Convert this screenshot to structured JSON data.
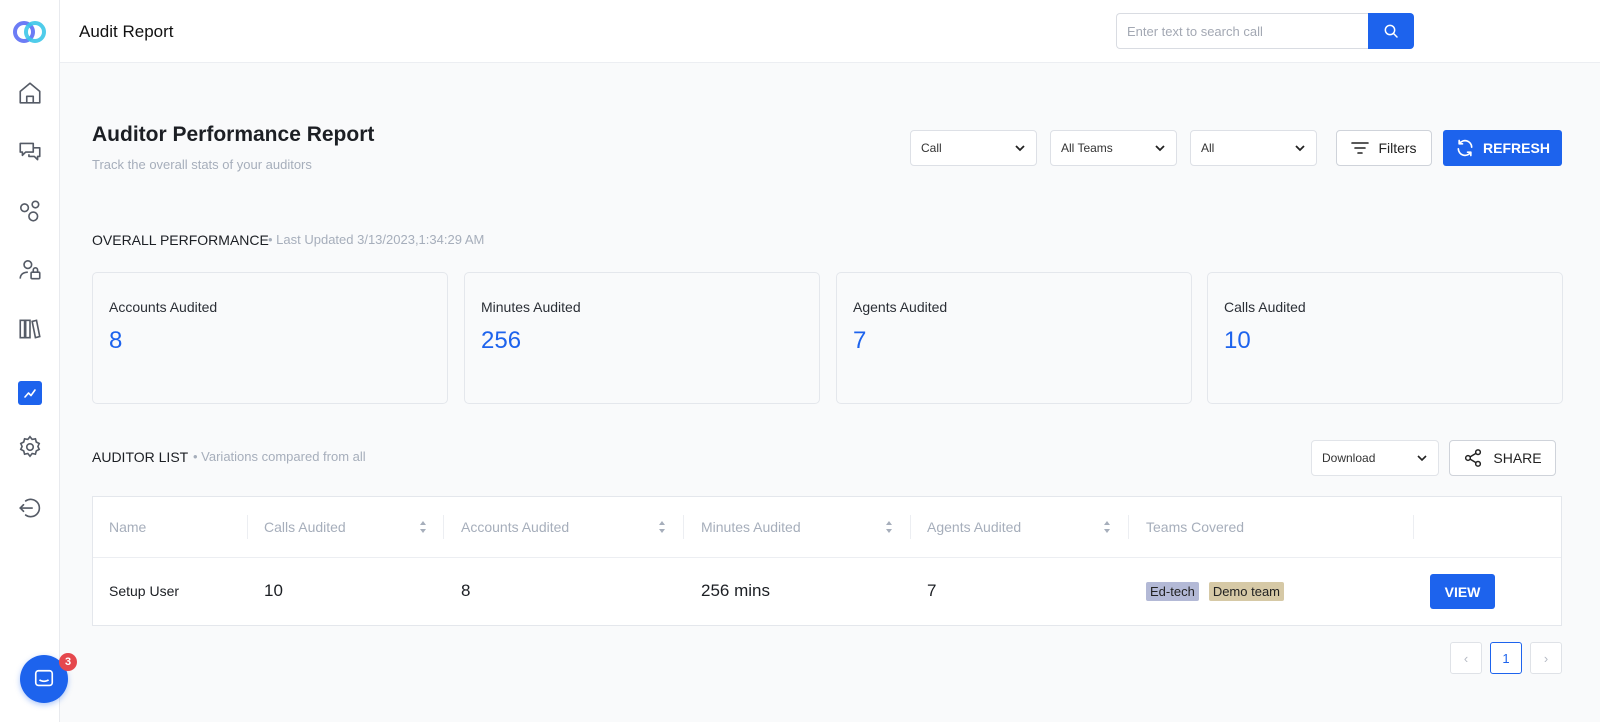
{
  "header": {
    "title": "Audit Report",
    "search_placeholder": "Enter text to search call"
  },
  "sidebar": {
    "items": [
      {
        "icon": "home-icon"
      },
      {
        "icon": "chat-icon"
      },
      {
        "icon": "bubbles-icon"
      },
      {
        "icon": "user-lock-icon"
      },
      {
        "icon": "library-icon"
      },
      {
        "icon": "chart-line-icon",
        "active": true
      },
      {
        "icon": "gear-icon"
      },
      {
        "icon": "logout-icon"
      }
    ],
    "chat_badge": "3"
  },
  "report": {
    "title": "Auditor Performance Report",
    "subtitle": "Track the overall stats of your auditors",
    "filters": {
      "type": "Call",
      "teams": "All Teams",
      "scope": "All"
    },
    "filters_label": "Filters",
    "refresh_label": "REFRESH"
  },
  "overall": {
    "label": "OVERALL PERFORMANCE",
    "note": "• Last Updated 3/13/2023,1:34:29 AM",
    "cards": [
      {
        "label": "Accounts Audited",
        "value": "8"
      },
      {
        "label": "Minutes Audited",
        "value": "256"
      },
      {
        "label": "Agents Audited",
        "value": "7"
      },
      {
        "label": "Calls Audited",
        "value": "10"
      }
    ]
  },
  "auditor_list": {
    "label": "AUDITOR LIST",
    "note": "• Variations compared from all",
    "download_label": "Download",
    "share_label": "SHARE",
    "columns": [
      "Name",
      "Calls Audited",
      "Accounts Audited",
      "Minutes Audited",
      "Agents Audited",
      "Teams Covered"
    ],
    "rows": [
      {
        "name": "Setup User",
        "calls": "10",
        "accounts": "8",
        "minutes": "256 mins",
        "agents": "7",
        "teams": [
          {
            "label": "Ed-tech",
            "color": "#b3b9d6"
          },
          {
            "label": "Demo team",
            "color": "#d6c9a6"
          }
        ],
        "action": "VIEW"
      }
    ]
  },
  "pagination": {
    "current": "1",
    "prev_symbol": "‹",
    "next_symbol": "›"
  },
  "colors": {
    "accent": "#1d63ed"
  }
}
